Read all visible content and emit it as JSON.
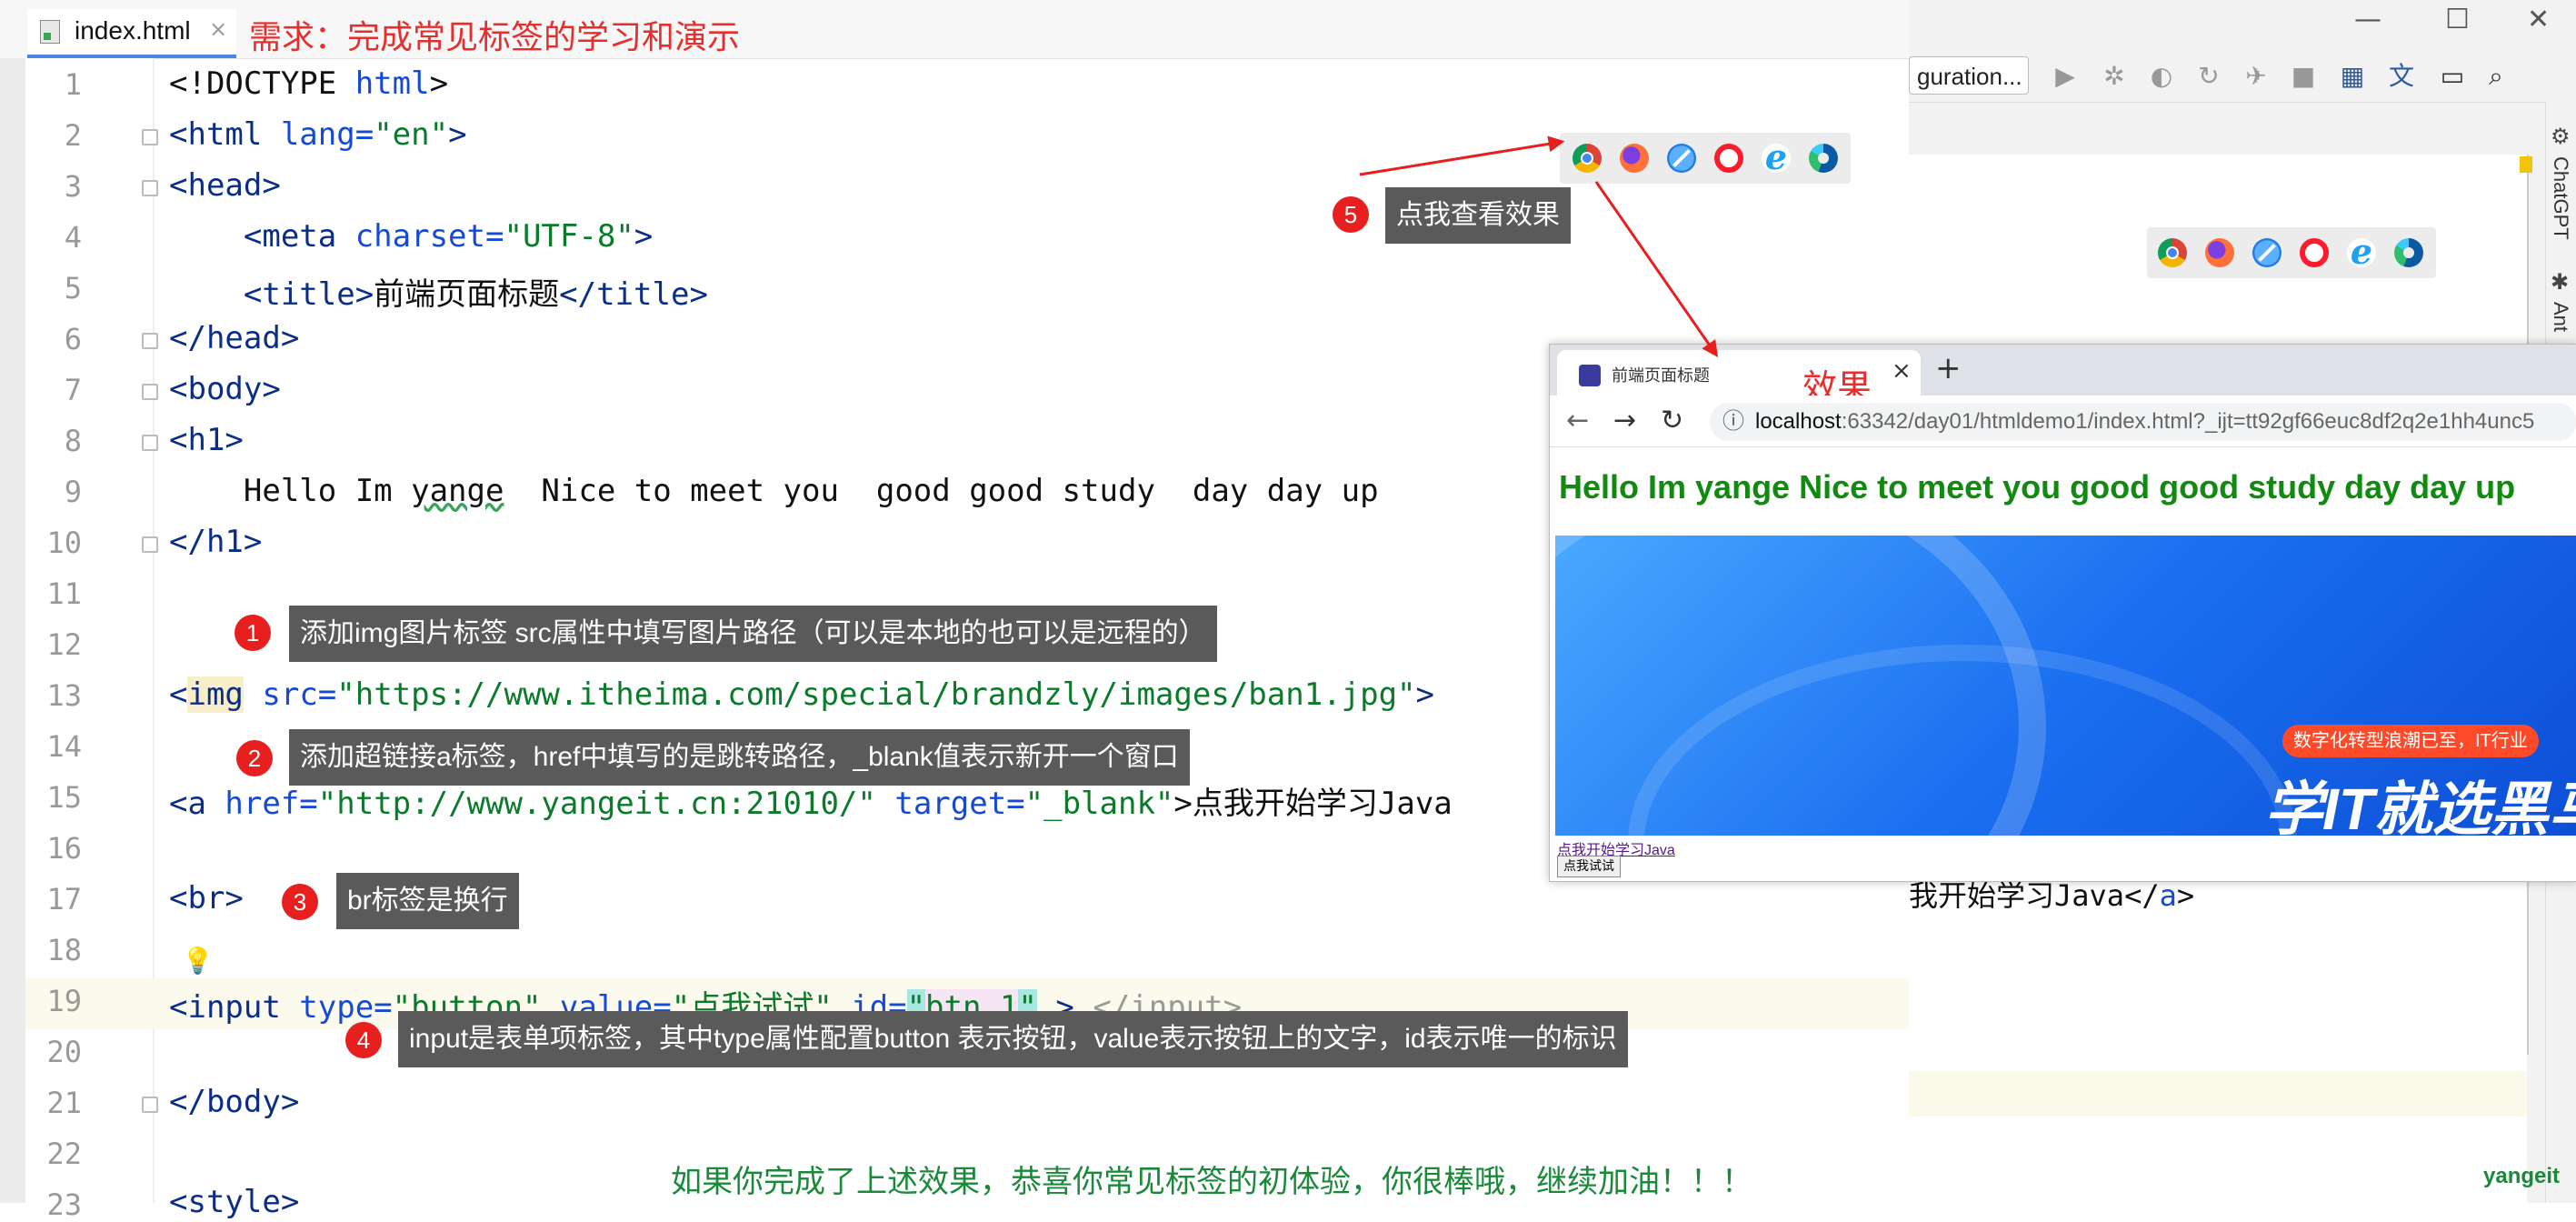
{
  "tab": {
    "file_name": "index.html",
    "close": "×"
  },
  "requirement_title": "需求：完成常见标签的学习和演示",
  "line_numbers": [
    "1",
    "2",
    "3",
    "4",
    "5",
    "6",
    "7",
    "8",
    "9",
    "10",
    "11",
    "12",
    "13",
    "14",
    "15",
    "16",
    "17",
    "18",
    "19",
    "20",
    "21",
    "22",
    "23"
  ],
  "code": {
    "l1_a": "<!DOCTYPE ",
    "l1_b": "html",
    "l1_c": ">",
    "l2_a": "<html ",
    "l2_b": "lang=",
    "l2_c": "\"en\"",
    "l2_d": ">",
    "l3": "<head>",
    "l4_a": "    <meta ",
    "l4_b": "charset=",
    "l4_c": "\"UTF-8\"",
    "l4_d": ">",
    "l5_a": "    <title>",
    "l5_b": "前端页面标题",
    "l5_c": "</title>",
    "l6": "</head>",
    "l7": "<body>",
    "l8": "<h1>",
    "l9_a": "    Hello Im ",
    "l9_b": "yange",
    "l9_c": "  Nice to meet you  good good study  day day up",
    "l10": "</h1>",
    "l13_a": "<",
    "l13_b": "img",
    "l13_c": " src=",
    "l13_d": "\"https://www.itheima.com/special/brandzly/images/ban1.jpg\"",
    "l13_e": ">",
    "l15_a": "<a ",
    "l15_b": "href=",
    "l15_c": "\"http://www.yangeit.cn:21010/\"",
    "l15_d": " target=",
    "l15_e": "\"_blank\"",
    "l15_f": ">点我开始学习Java",
    "l17": "<br>",
    "l19_a": "<input ",
    "l19_b": "type=",
    "l19_c": "\"button\"",
    "l19_d": " value=",
    "l19_e": "\"点我试试\"",
    "l19_f": " id=",
    "l19_g": "\"",
    "l19_h": "btn_1",
    "l19_i": "\"",
    "l19_j": " > ",
    "l19_k": "</input>",
    "l21": "</body>",
    "l23": "<style>"
  },
  "annotations": [
    {
      "num": "1",
      "text": "添加img图片标签 src属性中填写图片路径（可以是本地的也可以是远程的）"
    },
    {
      "num": "2",
      "text": "添加超链接a标签，href中填写的是跳转路径，_blank值表示新开一个窗口"
    },
    {
      "num": "3",
      "text": "br标签是换行"
    },
    {
      "num": "4",
      "text": "input是表单项标签，其中type属性配置button 表示按钮，value表示按钮上的文字，id表示唯一的标识"
    },
    {
      "num": "5",
      "text": "点我查看效果"
    }
  ],
  "browser_icons": [
    "chrome-icon",
    "firefox-icon",
    "safari-icon",
    "opera-icon",
    "ie-icon",
    "edge-icon"
  ],
  "browser": {
    "tab_title": "前端页面标题",
    "effect_label": "效果",
    "close": "×",
    "new_tab": "+",
    "url_host": "localhost",
    "url_rest": ":63342/day01/htmldemo1/index.html?_ijt=tt92gf66euc8df2q2e1hh4unc5",
    "h1": "Hello Im yange Nice to meet you good good study day day up",
    "banner_pill": "数字化转型浪潮已至，IT行业",
    "banner_text": "学IT就选黑马",
    "link": "点我开始学习Java",
    "button": "点我试试"
  },
  "bg_ide": {
    "config_label": "guration...",
    "code_tail_a": "我开始学习Java</",
    "code_tail_b": "a",
    "code_tail_c": ">",
    "side_chatgpt": "ChatGPT",
    "side_ant": "Ant",
    "watermark": "yangeit",
    "win_min": "—",
    "win_max": "☐",
    "win_close": "✕"
  },
  "bottom_message": "如果你完成了上述效果，恭喜你常见标签的初体验，你很棒哦，继续加油！！！",
  "colors": {
    "accent_red": "#e81f1f",
    "tag": "#0b2d86",
    "attr": "#174ad4",
    "string": "#0b7a2b",
    "h1_green": "#128a12"
  }
}
